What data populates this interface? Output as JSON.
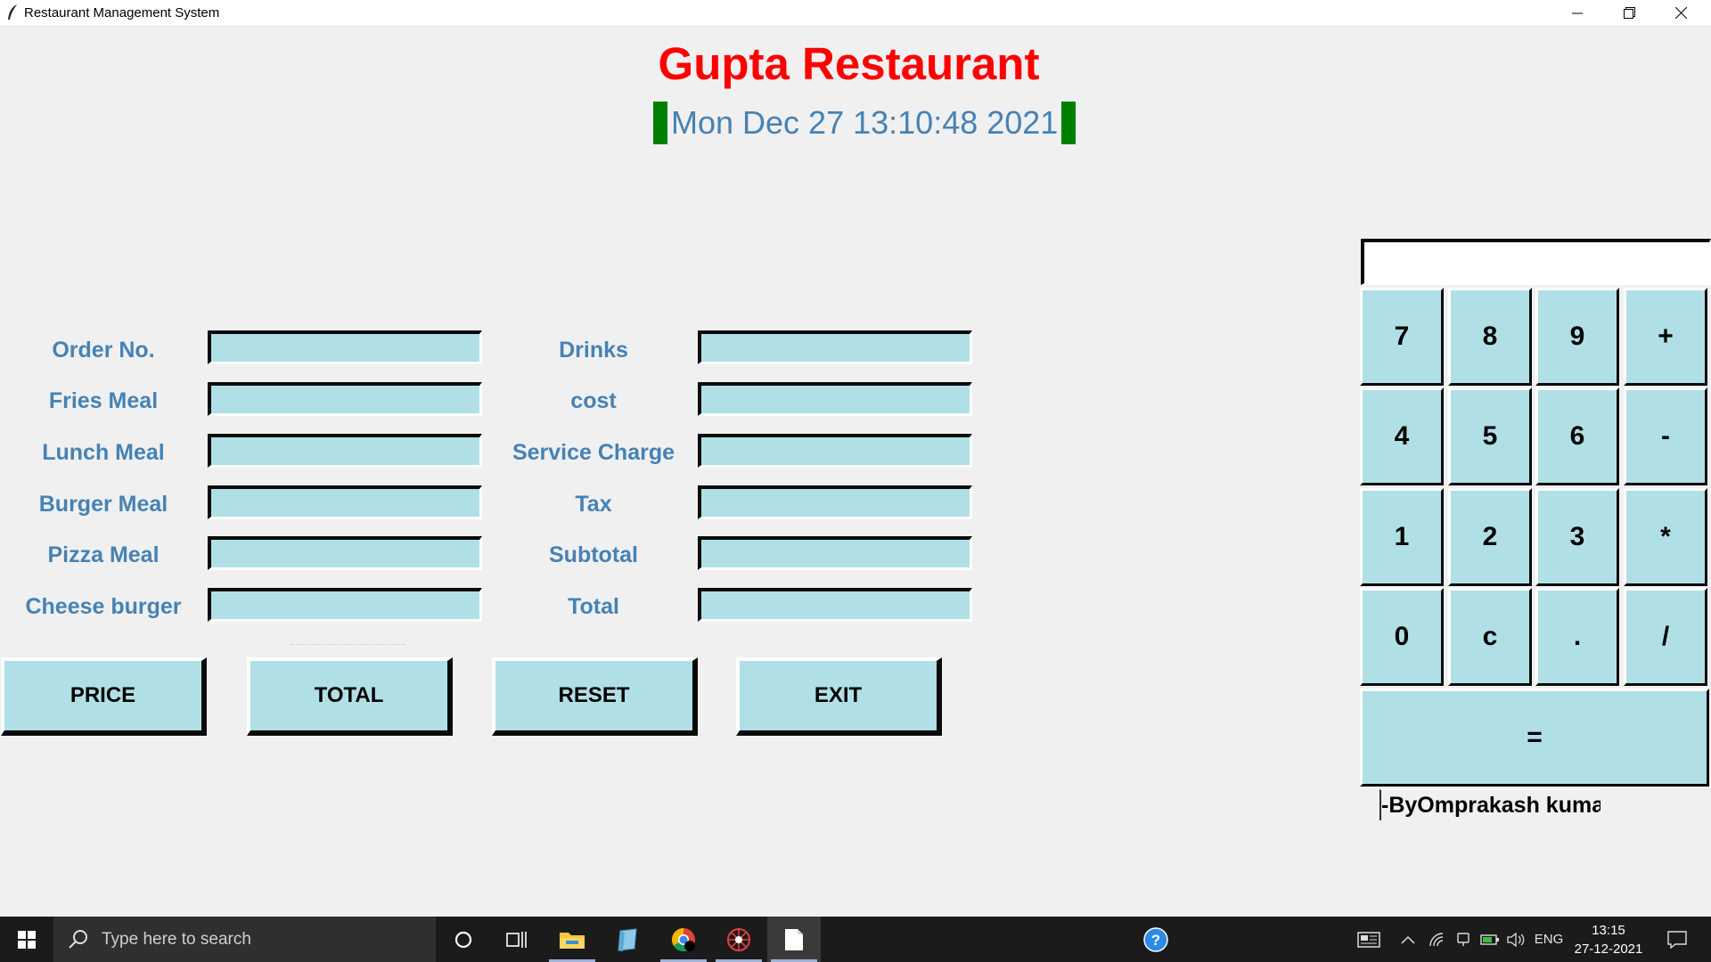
{
  "window": {
    "title": "Restaurant Management System"
  },
  "header": {
    "title": "Gupta Restaurant",
    "datetime": "Mon Dec 27 13:10:48 2021"
  },
  "left_form": {
    "fields": [
      {
        "label": "Order No.",
        "value": ""
      },
      {
        "label": "Fries Meal",
        "value": ""
      },
      {
        "label": "Lunch Meal",
        "value": ""
      },
      {
        "label": "Burger Meal",
        "value": ""
      },
      {
        "label": "Pizza Meal",
        "value": ""
      },
      {
        "label": "Cheese burger",
        "value": ""
      }
    ]
  },
  "right_form": {
    "fields": [
      {
        "label": "Drinks",
        "value": ""
      },
      {
        "label": "cost",
        "value": ""
      },
      {
        "label": "Service Charge",
        "value": ""
      },
      {
        "label": "Tax",
        "value": ""
      },
      {
        "label": "Subtotal",
        "value": ""
      },
      {
        "label": "Total",
        "value": ""
      }
    ]
  },
  "actions": {
    "price": "PRICE",
    "total": "TOTAL",
    "reset": "RESET",
    "exit": "EXIT"
  },
  "calculator": {
    "display": "",
    "keys": [
      "7",
      "8",
      "9",
      "+",
      "4",
      "5",
      "6",
      "-",
      "1",
      "2",
      "3",
      "*",
      "0",
      "c",
      ".",
      "/"
    ],
    "equals": "=",
    "author": "-ByOmprakash kuma"
  },
  "taskbar": {
    "search_placeholder": "Type here to search",
    "language": "ENG",
    "time": "13:15",
    "date": "27-12-2021"
  },
  "colors": {
    "title": "#ff0000",
    "label": "#4682b4",
    "field_bg": "#b0e0e6",
    "clock_bar": "#008000",
    "window_bg": "#f0f0f0"
  }
}
